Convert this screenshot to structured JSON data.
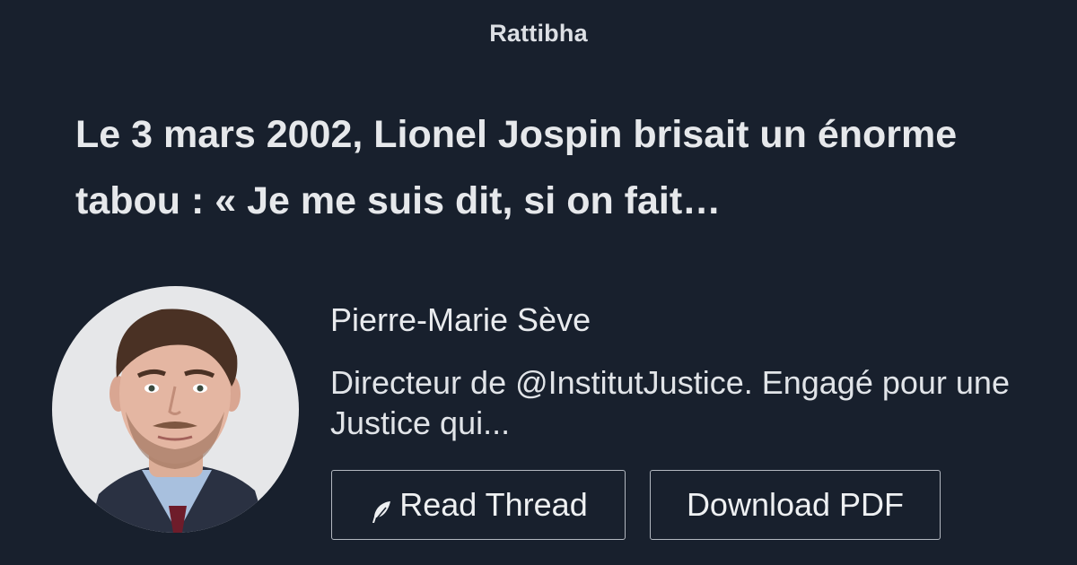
{
  "brand": "Rattibha",
  "thread": {
    "title": "Le 3 mars 2002, Lionel Jospin brisait un énorme tabou : « Je me suis dit, si on fait…"
  },
  "author": {
    "name": "Pierre-Marie Sève",
    "bio": "Directeur de @InstitutJustice. Engagé pour une Justice qui...",
    "avatar_icon": "author-portrait-photo"
  },
  "actions": {
    "read_label": "Read Thread",
    "read_icon": "feather-icon",
    "download_label": "Download PDF"
  },
  "colors": {
    "background": "#18202d",
    "text": "#e9ebee",
    "button_border": "#b3b8c0"
  }
}
